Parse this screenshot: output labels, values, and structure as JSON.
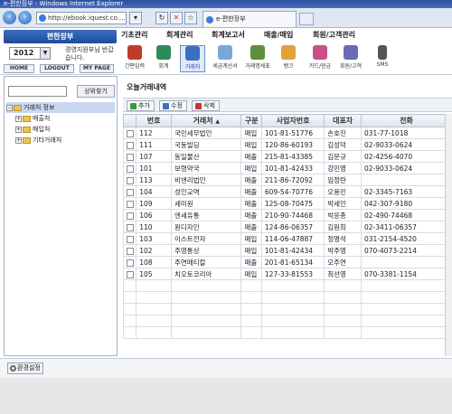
{
  "browser": {
    "title": "e-편한장부 - Windows Internet Explorer",
    "url": "http://ebook.iquest.co....",
    "tab_label": "e-편한장부"
  },
  "app": {
    "logo": "편한장부",
    "year": "2012",
    "welcome": "경영지원부님 반갑습니다.",
    "buttons": {
      "home": "HOME",
      "logout": "LOGOUT",
      "mypage": "MY PAGE"
    },
    "menus": [
      "기초관리",
      "회계관리",
      "회계보고서",
      "매출/매입",
      "회원/고객관리"
    ],
    "toolbar": [
      {
        "label": "간편입력",
        "icon": "quick-entry-icon",
        "color": "#c0392b"
      },
      {
        "label": "회계",
        "icon": "accounting-icon",
        "color": "#2e8b57"
      },
      {
        "label": "거래처",
        "icon": "client-icon",
        "color": "#3a6fc4"
      },
      {
        "label": "세금계산서",
        "icon": "tax-invoice-icon",
        "color": "#7aa7d8"
      },
      {
        "label": "거래명세표",
        "icon": "statement-icon",
        "color": "#5d8f3e"
      },
      {
        "label": "뱅크",
        "icon": "bank-icon",
        "color": "#e1a23a"
      },
      {
        "label": "카드/현금",
        "icon": "card-cash-icon",
        "color": "#c84f8b"
      },
      {
        "label": "회원/고객",
        "icon": "member-icon",
        "color": "#6b6bb5"
      },
      {
        "label": "SMS",
        "icon": "sms-icon",
        "color": "#555555"
      }
    ]
  },
  "sidebar": {
    "search_button": "상위찾기",
    "tree": [
      {
        "label": "거래처 정보",
        "level": 0
      },
      {
        "label": "매출처",
        "level": 1
      },
      {
        "label": "매입처",
        "level": 1
      },
      {
        "label": "기타거래처",
        "level": 1
      }
    ]
  },
  "main": {
    "title": "오늘거래내역",
    "actions": {
      "add": "추가",
      "edit": "수정",
      "delete": "삭제"
    },
    "columns": [
      "번호",
      "거래처",
      "구분",
      "사업자번호",
      "대표자",
      "전화"
    ],
    "rows": [
      [
        "112",
        "국민세무법인",
        "매입",
        "101-81-51776",
        "손호진",
        "031-77-1018"
      ],
      [
        "111",
        "국동빌딩",
        "매입",
        "120-86-60193",
        "김성덕",
        "02-9033-0624"
      ],
      [
        "107",
        "동일물산",
        "매출",
        "215-81-43385",
        "김문규",
        "02-4256-4070"
      ],
      [
        "101",
        "보령약국",
        "매입",
        "101-81-42433",
        "강민영",
        "02-9033-0624"
      ],
      [
        "113",
        "비엔리법인",
        "매출",
        "211-86-72092",
        "임정란",
        ""
      ],
      [
        "104",
        "성인교역",
        "매출",
        "609-54-70776",
        "오용민",
        "02-3345-7163"
      ],
      [
        "109",
        "세미원",
        "매출",
        "125-08-70475",
        "박세인",
        "042-307-9180"
      ],
      [
        "106",
        "엔세유통",
        "매출",
        "210-90-74468",
        "박윤종",
        "02-490-74468"
      ],
      [
        "110",
        "원디자인",
        "매출",
        "124-86-06357",
        "김원희",
        "02-3411-06357"
      ],
      [
        "103",
        "이스트전자",
        "매입",
        "114-06-47887",
        "정명석",
        "031-2154-4520"
      ],
      [
        "102",
        "주영통상",
        "매입",
        "101-81-42434",
        "박주영",
        "070-4073-2214"
      ],
      [
        "108",
        "주연메티칼",
        "매출",
        "201-81-65134",
        "오주연",
        ""
      ],
      [
        "105",
        "치오토코리아",
        "매입",
        "127-33-81553",
        "최선영",
        "070-3381-1154"
      ]
    ],
    "empty_rows": 5
  },
  "footer": {
    "settings_button": "환경설정"
  }
}
